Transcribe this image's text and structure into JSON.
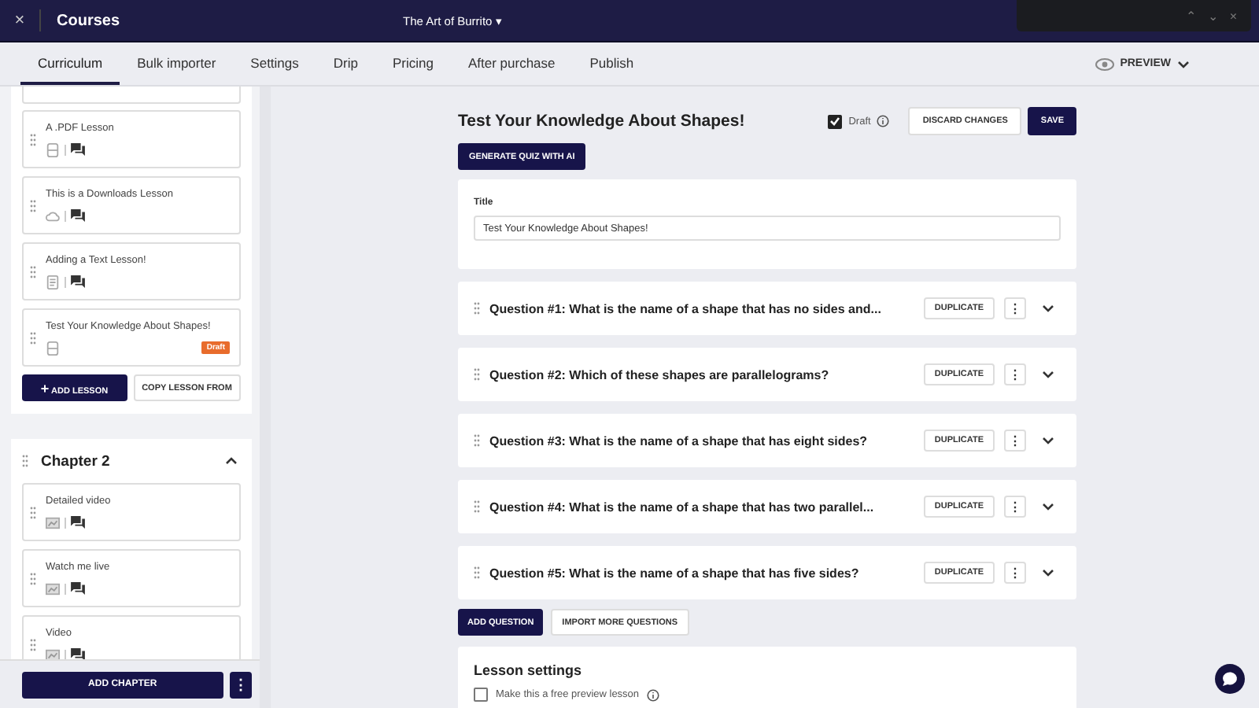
{
  "topbar": {
    "close": "×",
    "title": "Courses",
    "course": "The Art of Burrito",
    "course_caret": "▾"
  },
  "findbar": {
    "up": "⌃",
    "down": "⌄",
    "close": "×"
  },
  "tabs": [
    {
      "label": "Curriculum",
      "selected": true
    },
    {
      "label": "Bulk importer",
      "selected": false
    },
    {
      "label": "Settings",
      "selected": false
    },
    {
      "label": "Drip",
      "selected": false
    },
    {
      "label": "Pricing",
      "selected": false
    },
    {
      "label": "After purchase",
      "selected": false
    },
    {
      "label": "Publish",
      "selected": false
    }
  ],
  "preview": {
    "label": "PREVIEW"
  },
  "sidebar": {
    "chapters": [
      {
        "expanded": true,
        "lessons": [
          {
            "title": "A .PDF Lesson",
            "kind": "pdf",
            "comments": true,
            "draft": false
          },
          {
            "title": "This is a Downloads Lesson",
            "kind": "download",
            "comments": true,
            "draft": false
          },
          {
            "title": "Adding a Text Lesson!",
            "kind": "text",
            "comments": true,
            "draft": false
          },
          {
            "title": "Test Your Knowledge About Shapes!",
            "kind": "quiz",
            "comments": false,
            "draft": true,
            "badge": "Draft"
          }
        ],
        "add_lesson": "ADD LESSON",
        "add_lesson_icon": "+",
        "copy_lesson": "COPY LESSON FROM"
      },
      {
        "title": "Chapter 2",
        "expanded": true,
        "lessons": [
          {
            "title": "Detailed video",
            "kind": "video",
            "comments": true,
            "draft": false
          },
          {
            "title": "Watch me live",
            "kind": "video",
            "comments": true,
            "draft": false
          },
          {
            "title": "Video",
            "kind": "video",
            "comments": true,
            "draft": false
          }
        ]
      }
    ],
    "add_chapter": "ADD CHAPTER",
    "more": "⋮"
  },
  "lesson": {
    "heading": "Test Your Knowledge About Shapes!",
    "draft": {
      "label": "Draft",
      "checked": true
    },
    "discard": "DISCARD CHANGES",
    "save": "SAVE",
    "generate": "GENERATE QUIZ WITH AI",
    "title_field": {
      "label": "Title",
      "value": "Test Your Knowledge About Shapes!"
    },
    "questions": [
      {
        "text": "Question #1: What is the name of a shape that has no sides and...",
        "duplicate": "DUPLICATE",
        "more": "⋮"
      },
      {
        "text": "Question #2: Which of these shapes are parallelograms?",
        "duplicate": "DUPLICATE",
        "more": "⋮"
      },
      {
        "text": "Question #3: What is the name of a shape that has eight sides?",
        "duplicate": "DUPLICATE",
        "more": "⋮"
      },
      {
        "text": "Question #4: What is the name of a shape that has two parallel...",
        "duplicate": "DUPLICATE",
        "more": "⋮"
      },
      {
        "text": "Question #5: What is the name of a shape that has five sides?",
        "duplicate": "DUPLICATE",
        "more": "⋮"
      }
    ],
    "add_question": "ADD QUESTION",
    "import_questions": "IMPORT MORE QUESTIONS",
    "settings": {
      "heading": "Lesson settings",
      "free_preview": {
        "label": "Make this a free preview lesson",
        "checked": false
      }
    }
  }
}
